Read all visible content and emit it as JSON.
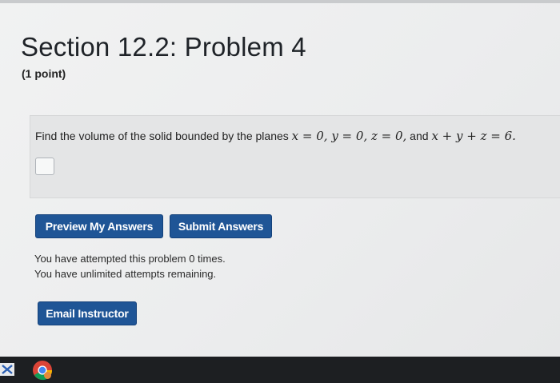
{
  "problem": {
    "title": "Section 12.2: Problem 4",
    "points": "(1 point)",
    "statement_prefix": "Find the volume of the solid bounded by the planes ",
    "eq1": "x = 0, y = 0, z = 0,",
    "conjunction": " and ",
    "eq2": "x + y + z = 6."
  },
  "answer": {
    "value": "",
    "placeholder": ""
  },
  "buttons": {
    "preview": "Preview My Answers",
    "submit": "Submit Answers",
    "email": "Email Instructor"
  },
  "status": {
    "attempted": "You have attempted this problem 0 times.",
    "remaining": "You have unlimited attempts remaining."
  },
  "taskbar": {
    "icons": [
      "start-icon",
      "chrome-icon"
    ],
    "background": "#1d1f22"
  },
  "colors": {
    "button": "#1f5596",
    "button_text": "#ffffff",
    "problem_box": "#e4e5e6"
  }
}
